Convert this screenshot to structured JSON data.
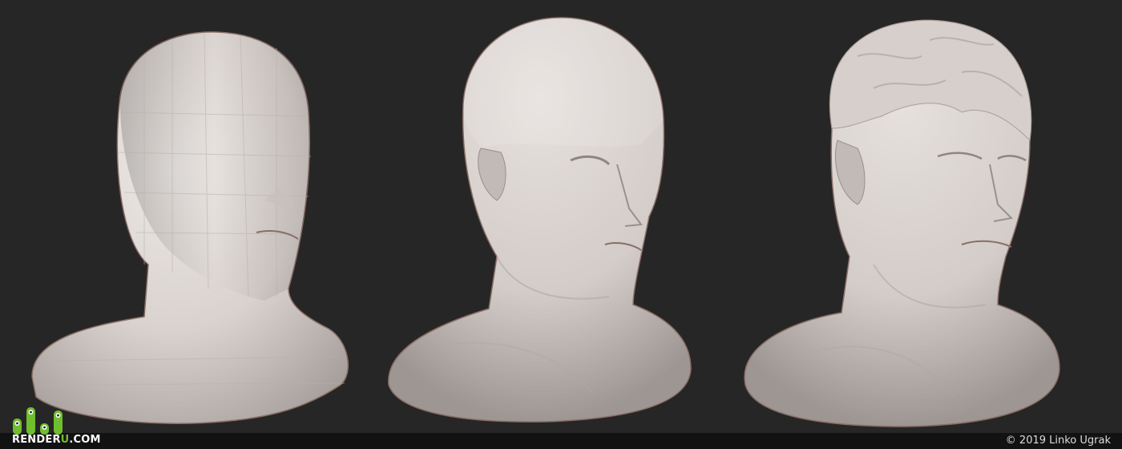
{
  "image": {
    "subject": "Three grey clay 3D-sculpt busts of a male head at increasing levels of detail",
    "background_color": "#262626",
    "clay_color": "#dcd6d2",
    "busts": [
      {
        "stage": "blockout",
        "surface": "faceted low-poly"
      },
      {
        "stage": "primary forms",
        "surface": "smooth, bald"
      },
      {
        "stage": "detailed",
        "surface": "smooth with sculpted hair"
      }
    ]
  },
  "footer": {
    "logo": {
      "prefix": "RENDER",
      "accent": "U",
      "suffix": ".COM",
      "accent_color": "#6fbe2e"
    },
    "copyright": "© 2019 Linko Ugrak"
  }
}
